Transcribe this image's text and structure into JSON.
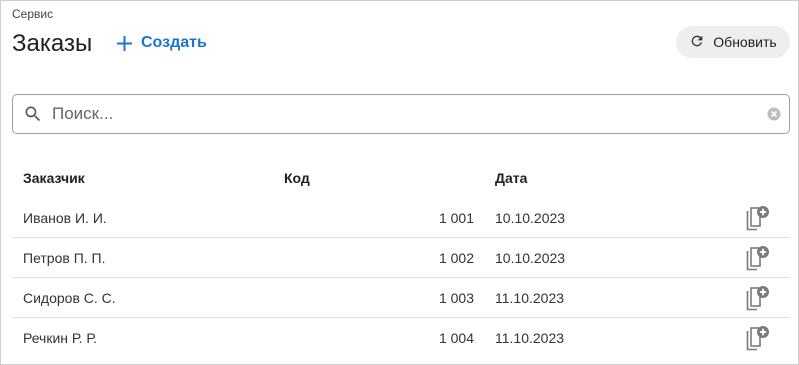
{
  "breadcrumb": "Сервис",
  "page_title": "Заказы",
  "toolbar": {
    "create_label": "Создать",
    "refresh_label": "Обновить",
    "accent_color": "#1976d2"
  },
  "search": {
    "placeholder": "Поиск...",
    "value": ""
  },
  "table": {
    "columns": [
      "Заказчик",
      "Код",
      "Дата"
    ],
    "rows": [
      {
        "customer": "Иванов И. И.",
        "code": "1 001",
        "date": "10.10.2023"
      },
      {
        "customer": "Петров П. П.",
        "code": "1 002",
        "date": "10.10.2023"
      },
      {
        "customer": "Сидоров С. С.",
        "code": "1 003",
        "date": "11.10.2023"
      },
      {
        "customer": "Речкин Р. Р.",
        "code": "1 004",
        "date": "11.10.2023"
      }
    ],
    "row_action_icon": "copy-add-icon"
  }
}
